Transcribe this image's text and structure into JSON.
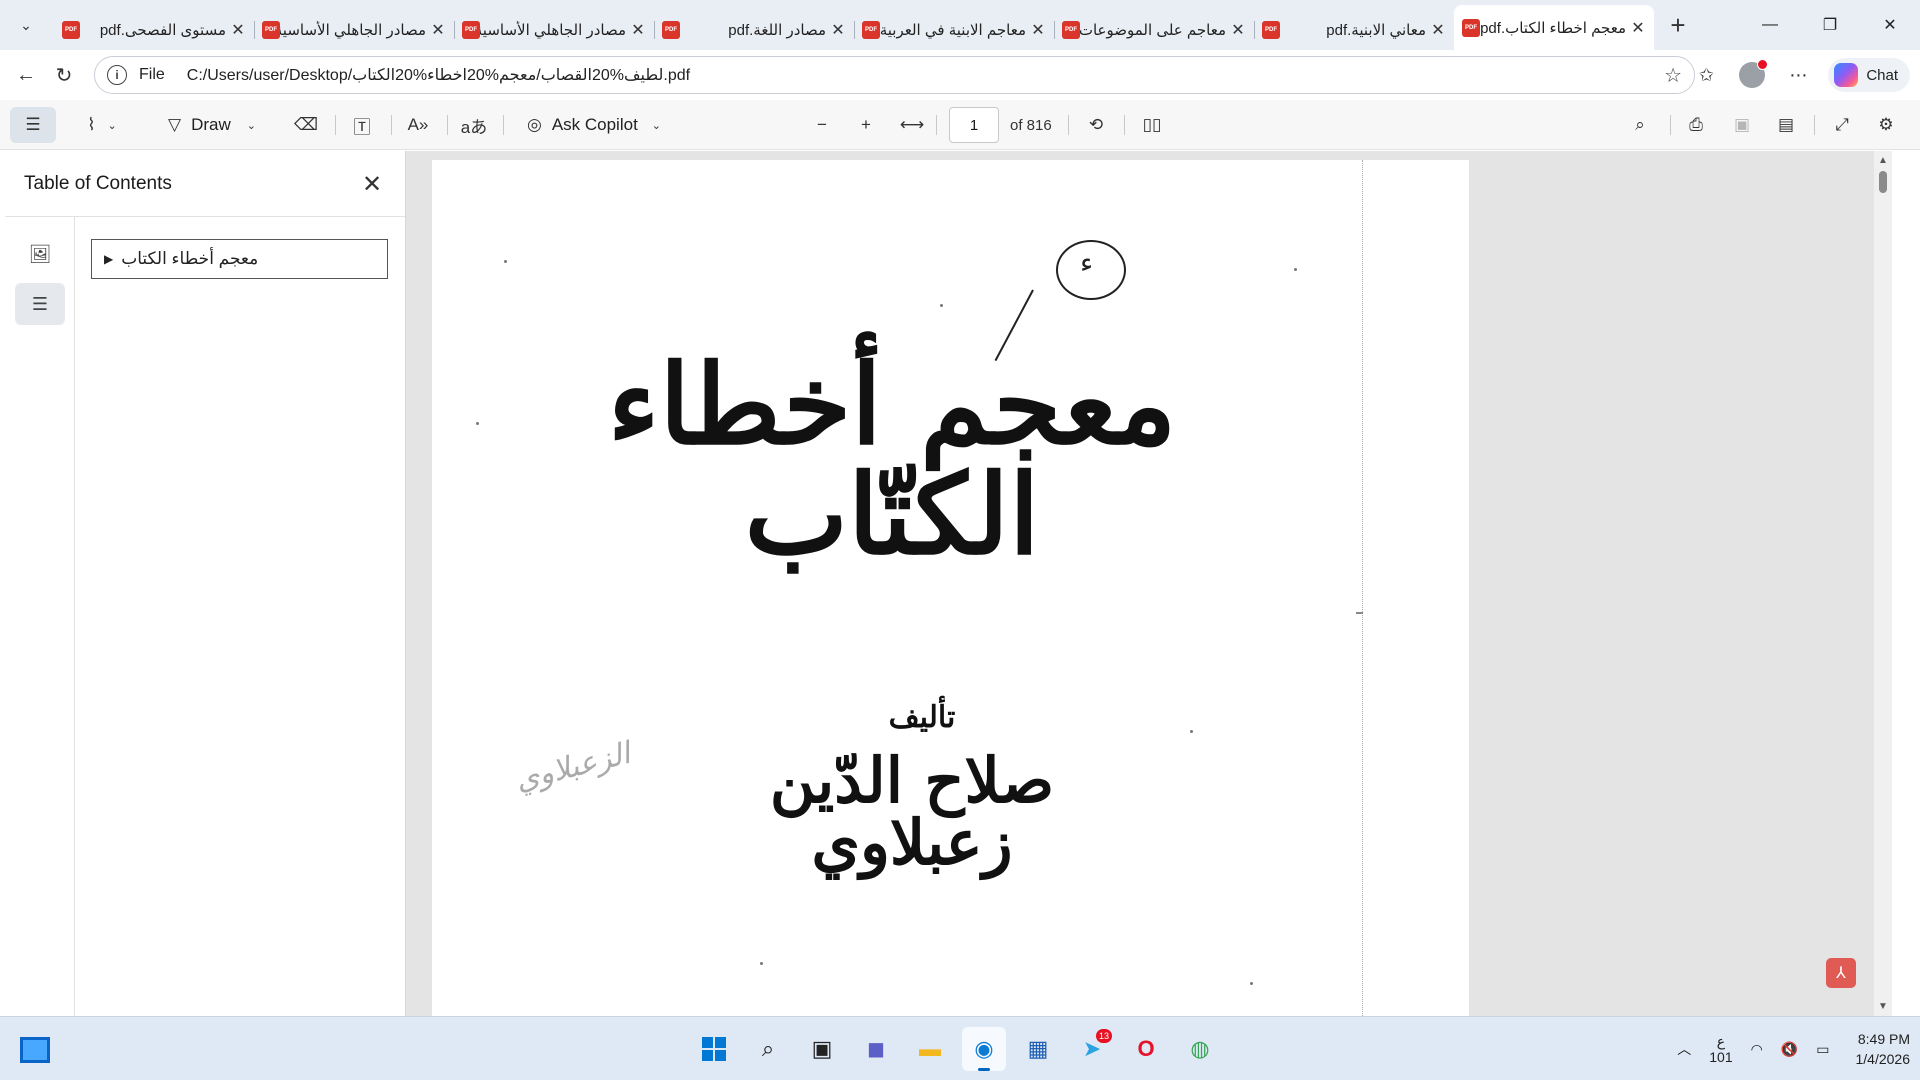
{
  "browser": {
    "tabs": [
      {
        "title": "مستوى الفصحى.pdf",
        "active": false
      },
      {
        "title": "مصادر الجاهلي الأساسية",
        "active": false
      },
      {
        "title": "مصادر الجاهلي الأساسية",
        "active": false
      },
      {
        "title": "مصادر اللغة.pdf",
        "active": false
      },
      {
        "title": "معاجم الابنية في العربية",
        "active": false
      },
      {
        "title": "معاجم على الموضوعات",
        "active": false
      },
      {
        "title": "معاني الابنية.pdf",
        "active": false
      },
      {
        "title": "معجم اخطاء الكتاب.pdf",
        "active": true
      }
    ],
    "pdf_icon_text": "PDF",
    "tab_list_icon": "chevron-down-icon",
    "new_tab_icon": "plus-icon",
    "window_controls": {
      "minimize": "—",
      "restore": "❐",
      "close": "✕"
    },
    "address": {
      "scheme": "File",
      "url": "C:/Users/user/Desktop/لطيف%20القصاب/معجم%20اخطاء%20الكتاب.pdf"
    },
    "chat_label": "Chat"
  },
  "pdf_toolbar": {
    "draw_label": "Draw",
    "copilot_label": "Ask Copilot",
    "page_current": "1",
    "page_total_label": "of 816"
  },
  "sidebar": {
    "title": "Table of Contents",
    "toc_items": [
      {
        "label": "معجم أخطاء الكتاب",
        "expanded": false
      }
    ]
  },
  "document": {
    "title": "معجم أخطاء الكتّاب",
    "annotation_char": "ء",
    "author_label": "تأليف",
    "author_name": "صلاح الدّين زعبلاوي",
    "handwritten_note": "الزعبلاوي"
  },
  "taskbar": {
    "telegram_badge": "13",
    "language": {
      "line1": "ع",
      "line2": "101"
    },
    "clock": {
      "time": "8:49 PM",
      "date": "1/4/2026"
    }
  },
  "colors": {
    "accent": "#0067c0",
    "tab_strip_bg": "#e9eef5",
    "pdf_icon": "#d9352b"
  }
}
